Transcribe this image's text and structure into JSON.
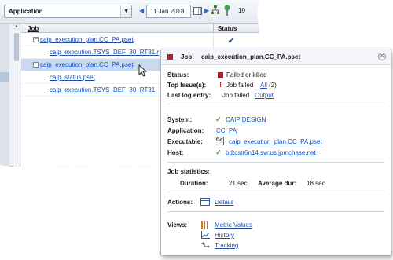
{
  "toolbar": {
    "app_select_value": "Application",
    "date_value": "11 Jan 2018",
    "zoom_value": "10"
  },
  "grid": {
    "columns": [
      "Job",
      "Status"
    ],
    "rows": [
      {
        "label": "caip_execution_plan.CC_PA.pset",
        "expander": "−",
        "status": "✔"
      },
      {
        "label": "caip_execution.TSYS_DEF_80_RT81.r",
        "expander": "",
        "status": ""
      },
      {
        "label": "caip_execution_plan.CC_PA.pset",
        "expander": "−",
        "status": ""
      },
      {
        "label": "caip_status.pset",
        "expander": "",
        "status": ""
      },
      {
        "label": "caip_execution.TSYS_DEF_80_RT31",
        "expander": "",
        "status": ""
      }
    ]
  },
  "popup": {
    "title_label": "Job:",
    "title_job": "caip_execution_plan.CC_PA.pset",
    "status_label": "Status:",
    "status_value": "Failed or killed",
    "top_issues_label": "Top Issue(s):",
    "top_issues_value": "Job failed",
    "top_issues_all": "All",
    "top_issues_count": "(2)",
    "last_log_label": "Last log entry:",
    "last_log_value": "Job failed",
    "last_log_link": "Output",
    "system_label": "System:",
    "system_value": "CAIP DESIGN",
    "application_label": "Application:",
    "application_value": "CC_PA",
    "executable_label": "Executable:",
    "executable_icon_text": "Do",
    "executable_value": "caip_execution_plan.CC_PA.pset",
    "host_label": "Host:",
    "host_value": "bdtcstr6n14.svr.us.jpmchase.net",
    "job_stats_label": "Job statistics:",
    "duration_label": "Duration:",
    "duration_value": "21 sec",
    "avg_label": "Average dur:",
    "avg_value": "18 sec",
    "actions_label": "Actions:",
    "details_link": "Details",
    "views_label": "Views:",
    "metric_values_link": "Metric Values",
    "history_link": "History",
    "tracking_link": "Tracking"
  },
  "colors": {
    "failed": "#b5212a",
    "link": "#1f4fa8",
    "ok_check": "#48a52e"
  }
}
